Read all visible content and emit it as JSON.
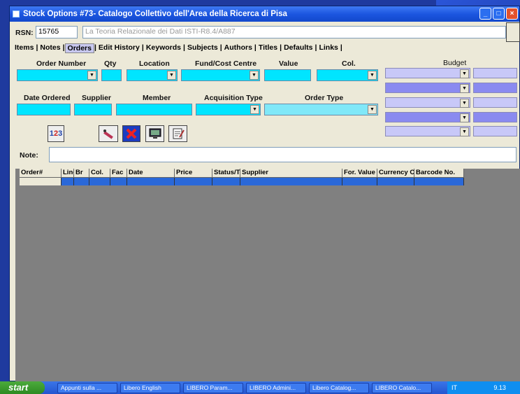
{
  "window": {
    "title": "Stock Options #73- Catalogo Collettivo dell'Area della Ricerca di Pisa"
  },
  "rsn": {
    "label": "RSN:",
    "value": "15765",
    "title_value": "La Teoria Relazionale dei Dati ISTI-R8.4/A887"
  },
  "tabs": [
    "Items",
    "Notes",
    "Orders",
    "Edit History",
    "Keywords",
    "Subjects",
    "Authors",
    "Titles",
    "Defaults",
    "Links"
  ],
  "form": {
    "order_number": "Order Number",
    "qty": "Qty",
    "location": "Location",
    "fund": "Fund/Cost Centre",
    "value": "Value",
    "col": "Col.",
    "budget": "Budget",
    "date_ordered": "Date Ordered",
    "supplier": "Supplier",
    "member": "Member",
    "acq_type": "Acquisition Type",
    "order_type": "Order Type",
    "note": "Note:"
  },
  "grid": {
    "columns": [
      "Order#",
      "Line",
      "Br",
      "Col.",
      "Fac",
      "Date",
      "Price",
      "Status/T",
      "Supplier",
      "For. Value",
      "Currency Co",
      "Barcode No."
    ]
  },
  "taskbar": {
    "start": "start",
    "items": [
      "Appunti sulla ...",
      "Libero English",
      "LIBERO Param...",
      "LIBERO Admini...",
      "Libero Catalog...",
      "LIBERO Catalo..."
    ],
    "lang": "IT",
    "clock": "9.13"
  }
}
